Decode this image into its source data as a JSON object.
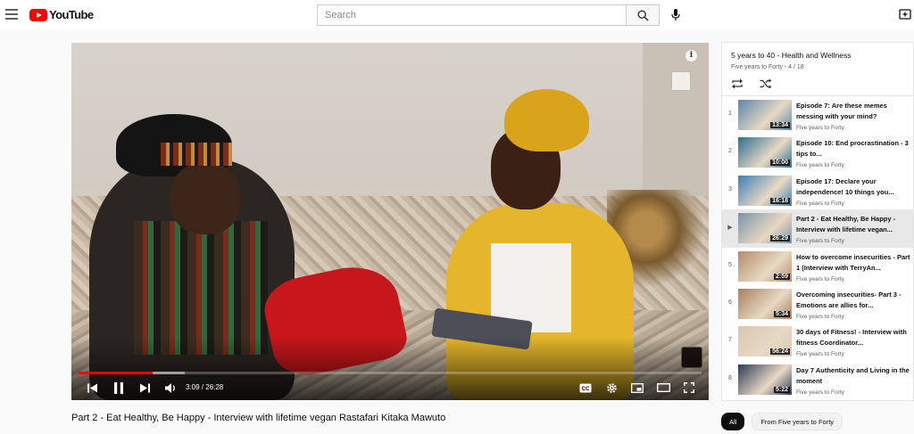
{
  "header": {
    "logo_text": "YouTube",
    "search_placeholder": "Search"
  },
  "player": {
    "current_time": "3:09",
    "duration": "26:28",
    "time_text": "3:09 / 26:28",
    "progress_fraction": 0.119,
    "buffered_fraction": 0.17,
    "progress_color": "#ff0000"
  },
  "video": {
    "title": "Part 2 - Eat Healthy, Be Happy - Interview with lifetime vegan Rastafari Kitaka Mawuto"
  },
  "playlist": {
    "title": "5 years to 40 - Health and Wellness",
    "channel_position": "Five years to Forty - 4 / 18",
    "items": [
      {
        "index": "1",
        "title": "Episode 7: Are these memes messing with your mind?",
        "channel": "Five years to Forty",
        "duration": "13:34",
        "thumb_color": "#5a87a8"
      },
      {
        "index": "2",
        "title": "Episode 10: End procrastination - 3 tips to...",
        "channel": "Five years to Forty",
        "duration": "10:00",
        "thumb_color": "#2d6f8f"
      },
      {
        "index": "3",
        "title": "Episode 17: Declare your independence! 10 things you...",
        "channel": "Five years to Forty",
        "duration": "16:18",
        "thumb_color": "#3e7fb3"
      },
      {
        "index": "▶",
        "title": "Part 2 - Eat Healthy, Be Happy - Interview with lifetime vegan...",
        "channel": "Five years to Forty",
        "duration": "26:29",
        "thumb_color": "#7a93a8",
        "active": true
      },
      {
        "index": "5",
        "title": "How to overcome insecurities - Part 1 (Interview with TerryAn...",
        "channel": "Five years to Forty",
        "duration": "2:59",
        "thumb_color": "#b58c6a"
      },
      {
        "index": "6",
        "title": "Overcoming insecurities- Part 3 - Emotions are allies for...",
        "channel": "Five years to Forty",
        "duration": "5:34",
        "thumb_color": "#a87f5e"
      },
      {
        "index": "7",
        "title": "30 days of Fitness! - Interview with fitness Coordinator...",
        "channel": "Five years to Forty",
        "duration": "56:24",
        "thumb_color": "#d8c6b3"
      },
      {
        "index": "8",
        "title": "Day 7 Authenticity and Living in the moment",
        "channel": "Five years to Forty",
        "duration": "5:22",
        "thumb_color": "#2f3a57"
      }
    ]
  },
  "chips": {
    "all": "All",
    "from_channel": "From Five years to Forty"
  }
}
